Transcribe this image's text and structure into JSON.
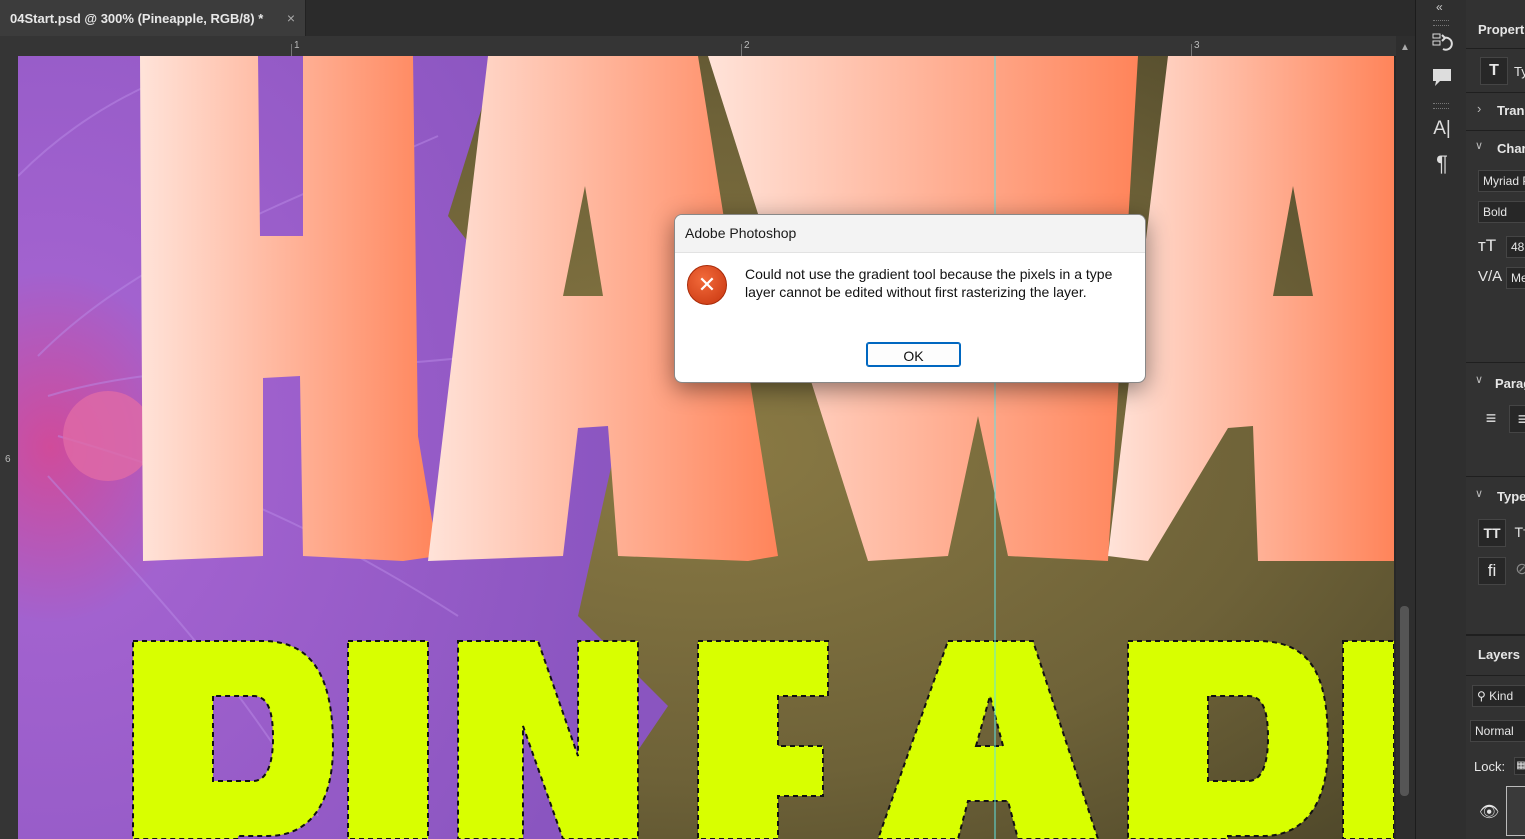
{
  "document_tab": {
    "title": "04Start.psd @ 300% (Pineapple, RGB/8) *",
    "close_glyph": "×"
  },
  "rulers": {
    "horizontal_ticks": [
      "1",
      "2",
      "3"
    ],
    "vertical_ticks": [
      "6"
    ]
  },
  "canvas": {
    "headline_top": "HAWA",
    "headline_bottom": "PINEAPP",
    "gradient_start": "#ffe3d9",
    "gradient_end": "#ff845a",
    "selection_text_color": "#d8ff00",
    "flower_color": "#8f58c4",
    "pineapple_color": "#7a6a3a"
  },
  "panel_collapse_icon": "double-chevron-left-icon",
  "tool_strip": {
    "icons": [
      "history-icon",
      "comment-icon",
      "character-icon",
      "paragraph-icon"
    ]
  },
  "properties_panel": {
    "title": "Properti",
    "layer_type_label": "Ty",
    "transform_label": "Tran",
    "character_label": "Char",
    "font_family": "Myriad P",
    "font_style": "Bold",
    "font_size": "48",
    "tracking": "Me",
    "paragraph_label": "Parag",
    "type_options_label": "Type"
  },
  "layers_panel": {
    "title": "Layers",
    "filter_label": "Kind",
    "blend_mode": "Normal",
    "lock_label": "Lock:"
  },
  "dialog": {
    "title": "Adobe Photoshop",
    "icon": "error-icon",
    "icon_glyph": "✕",
    "message": "Could not use the gradient tool because the pixels in a type layer cannot be edited without first rasterizing the layer.",
    "ok_label": "OK"
  }
}
